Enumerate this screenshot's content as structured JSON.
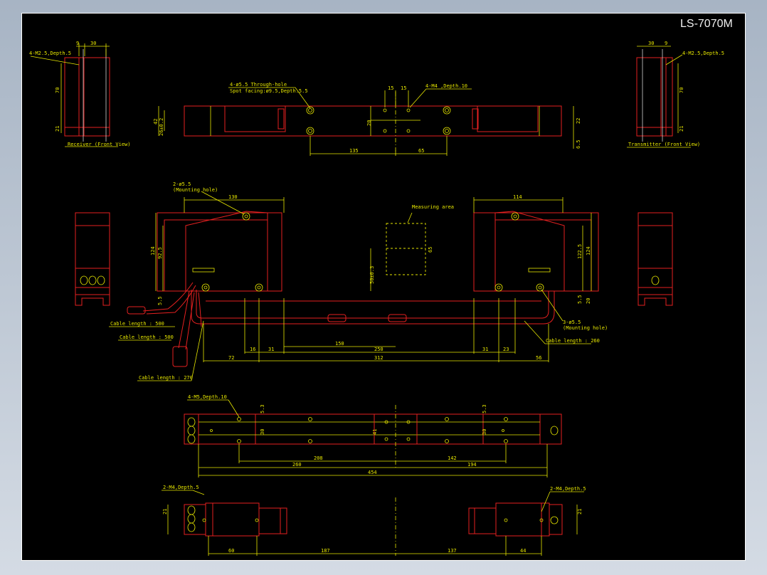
{
  "drawing": {
    "title": "LS-7070M",
    "colors": {
      "background": "#000000",
      "outline": "#e52020",
      "dimension": "#e6e600",
      "centerline": "#ffffff"
    }
  },
  "notes": {
    "receiver_tap": "4-M2.5,Depth.5",
    "transmitter_tap": "4-M2.5,Depth.5",
    "receiver_front_view": "Receiver (Front View)",
    "transmitter_front_view": "Transmitter (Front View)",
    "through_hole_1": "4-ø5.5 Through-hole",
    "through_hole_2": "Spot facing:ø9.5,Depth.5.5",
    "m4_depth": "4-M4 ,Depth.10",
    "mount_hole_left_1": "2-ø5.5",
    "mount_hole_left_2": "(Mounting hole)",
    "measuring_area": "Measuring area",
    "cable_500a": "Cable length : 500",
    "cable_500b": "Cable length : 500",
    "cable_270": "Cable length : 270",
    "cable_260": "Cable length : 260",
    "mount_hole_right_1": "3-ø5.5",
    "mount_hole_right_2": "(Mounting hole)",
    "m5_depth": "4-M5,Depth.10",
    "m4_left": "2-M4,Depth.5",
    "m4_right": "2-M4,Depth.5"
  },
  "dims": {
    "d9": "9",
    "d30": "30",
    "d70": "70",
    "d21": "21",
    "d30r": "30",
    "d9r": "9",
    "d70r": "70",
    "d21r": "21",
    "d42": "42",
    "d26": "26±0.2",
    "d15a": "15",
    "d15b": "15",
    "d20": "20",
    "d22": "22",
    "d65h": "6.5",
    "d135": "135",
    "d65": "65",
    "d130": "130",
    "d114": "114",
    "d124": "124",
    "d925": "92.5",
    "d55": "5.5",
    "d65m": "65",
    "d50": "50±0.3",
    "d1225": "122.5",
    "d124r": "124",
    "d55r": "5.5",
    "d20r": "20",
    "d16": "16",
    "d31": "31",
    "d150": "150",
    "d250": "250",
    "d31r": "31",
    "d23": "23",
    "d72": "72",
    "d312": "312",
    "d56": "56",
    "d53a": "5.3",
    "d53b": "5.3",
    "d30a": "30",
    "d41": "41",
    "d30b": "30",
    "d208": "208",
    "d142": "142",
    "d260": "260",
    "d194": "194",
    "d454": "454",
    "d21a": "21",
    "d21b": "21",
    "d60": "60",
    "d187": "187",
    "d137": "137",
    "d44": "44"
  }
}
